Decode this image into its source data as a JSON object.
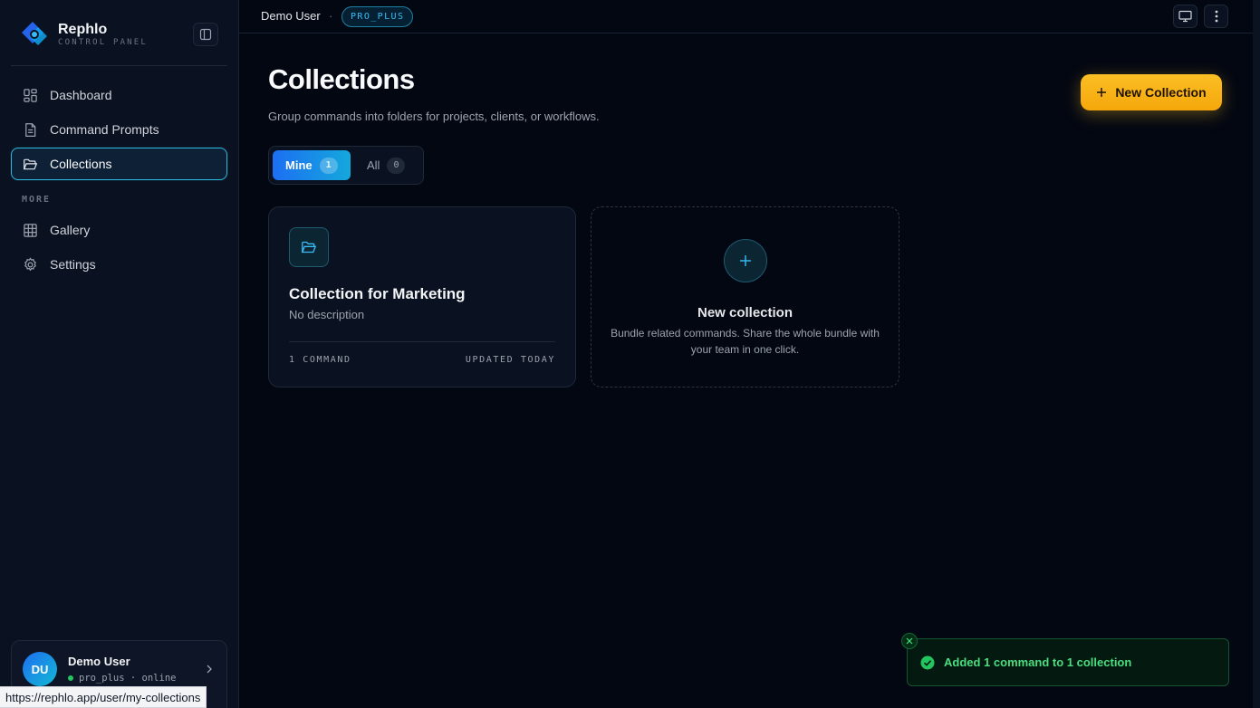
{
  "brand": {
    "name": "Rephlo",
    "subtitle": "CONTROL PANEL"
  },
  "sidebar": {
    "items": [
      {
        "label": "Dashboard",
        "icon": "dashboard-icon"
      },
      {
        "label": "Command Prompts",
        "icon": "document-icon"
      },
      {
        "label": "Collections",
        "icon": "folder-open-icon",
        "active": true
      }
    ],
    "more_label": "MORE",
    "more_items": [
      {
        "label": "Gallery",
        "icon": "grid-icon"
      },
      {
        "label": "Settings",
        "icon": "gear-icon"
      }
    ],
    "user": {
      "initials": "DU",
      "name": "Demo User",
      "status": "pro_plus · online"
    }
  },
  "topbar": {
    "user_name": "Demo User",
    "separator": "·",
    "plan_badge": "PRO_PLUS"
  },
  "main": {
    "title": "Collections",
    "subtitle": "Group commands into folders for projects, clients, or workflows.",
    "new_button_label": "New Collection",
    "tabs": [
      {
        "label": "Mine",
        "count": "1",
        "active": true
      },
      {
        "label": "All",
        "count": "0",
        "active": false
      }
    ],
    "collections": [
      {
        "title": "Collection for Marketing",
        "description": "No description",
        "command_count": "1 COMMAND",
        "updated": "UPDATED TODAY"
      }
    ],
    "new_card": {
      "title": "New collection",
      "description": "Bundle related commands. Share the whole bundle with your team in one click."
    }
  },
  "toast": {
    "message": "Added 1 command to 1 collection"
  },
  "status_url": "https://rephlo.app/user/my-collections",
  "colors": {
    "accent": "#2bb7d9",
    "primary_button": "#fbbf24",
    "success": "#4ade80",
    "background": "#030712"
  }
}
